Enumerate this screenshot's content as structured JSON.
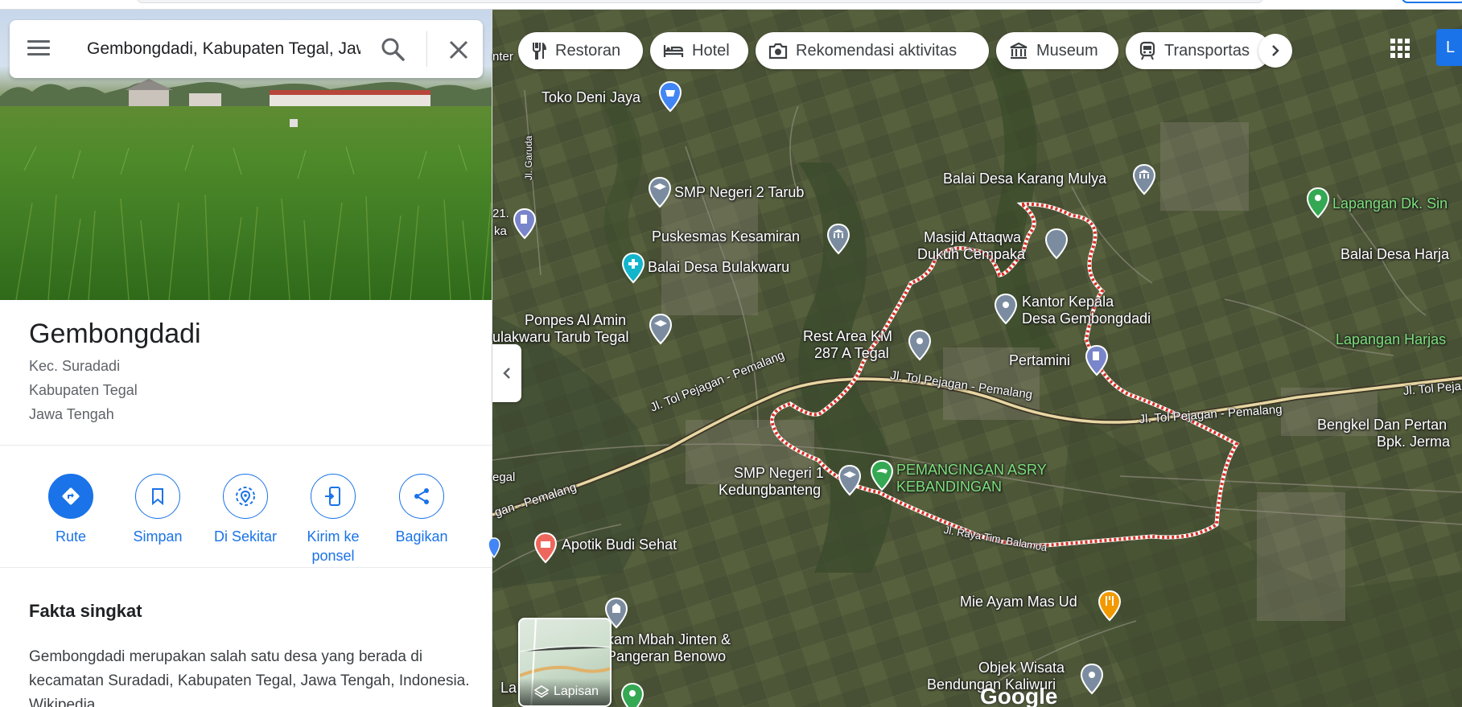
{
  "search": {
    "value": "Gembongdadi, Kabupaten Tegal, Jawa Tengah"
  },
  "place": {
    "title": "Gembongdadi",
    "address_lines": [
      "Kec. Suradadi",
      "Kabupaten Tegal",
      "Jawa Tengah"
    ]
  },
  "actions": [
    {
      "label": "Rute",
      "icon": "directions-icon"
    },
    {
      "label": "Simpan",
      "icon": "bookmark-icon"
    },
    {
      "label": "Di Sekitar",
      "icon": "nearby-icon"
    },
    {
      "label_line1": "Kirim ke",
      "label_line2": "ponsel",
      "icon": "send-to-phone-icon"
    },
    {
      "label": "Bagikan",
      "icon": "share-icon"
    }
  ],
  "facts": {
    "heading": "Fakta singkat",
    "text": "Gembongdadi merupakan salah satu desa yang berada di kecamatan Suradadi, Kabupaten Tegal, Jawa Tengah, Indonesia.",
    "link": "Wikipedia"
  },
  "chips": [
    {
      "label": "Restoran",
      "icon": "restaurant-icon"
    },
    {
      "label": "Hotel",
      "icon": "hotel-icon"
    },
    {
      "label": "Rekomendasi aktivitas",
      "icon": "camera-icon"
    },
    {
      "label": "Museum",
      "icon": "museum-icon"
    },
    {
      "label": "Transportas",
      "icon": "train-icon"
    }
  ],
  "signin_label": "L",
  "map_labels": {
    "toko": "Toko Deni Jaya",
    "smp2": "SMP Negeri 2 Tarub",
    "puskesmas": "Puskesmas Kesamiran",
    "balai_bulakwaru": "Balai Desa Bulakwaru",
    "ponpes1": "Ponpes Al Amin",
    "ponpes2": "ulakwaru Tarub Tegal",
    "rest1": "Rest Area KM",
    "rest2": "287 A Tegal",
    "balai_karang": "Balai Desa Karang Mulya",
    "masjid1": "Masjid Attaqwa",
    "masjid2": "Dukuh Cempaka",
    "kantor1": "Kantor Kepala",
    "kantor2": "Desa Gembongdadi",
    "pertamini": "Pertamini",
    "lapangan_dk": "Lapangan Dk. Sin",
    "balai_harja": "Balai Desa Harja",
    "lapangan_harjas": "Lapangan Harjas",
    "bengkel1": "Bengkel Dan Pertan",
    "bengkel2": "Bpk. Jerma",
    "smp1_1": "SMP Negeri 1",
    "smp1_2": "Kedungbanteng",
    "pemancingan1": "PEMANCINGAN ASRY",
    "pemancingan2": "KEBANDINGAN",
    "apotik": "Apotik Budi Sehat",
    "mie": "Mie Ayam Mas Ud",
    "makam1": "kam Mbah Jinten &",
    "makam2": "Pangeran Benowo",
    "objek1": "Objek Wisata",
    "objek2": "Bendungan Kaliwuri",
    "tol1": "Jl. Tol Pejagan - Pemalang",
    "tol2": "Jl. Tol Pejagan - Pemalang",
    "tol3": "Jl. Tol Pejagan - Pemalang",
    "tol4": "Jl. Tol Pejagan - Pemalang",
    "tol5": "Jl. Tol Peja",
    "tol_left": "gan - Pemalang",
    "raya": "Jl. Raya Tim. Balamoa",
    "garuda": "Jl. Garuda",
    "left_a": "nter",
    "left_b": "21.",
    "left_c": "ka",
    "left_d": "egal",
    "left_e": "La",
    "google": "Google"
  },
  "layers_label": "Lapisan",
  "colors": {
    "accent": "#1a73e8",
    "boundary": "#d93025",
    "toll_road": "#e8d7a3",
    "label_green": "#7ce07a"
  }
}
